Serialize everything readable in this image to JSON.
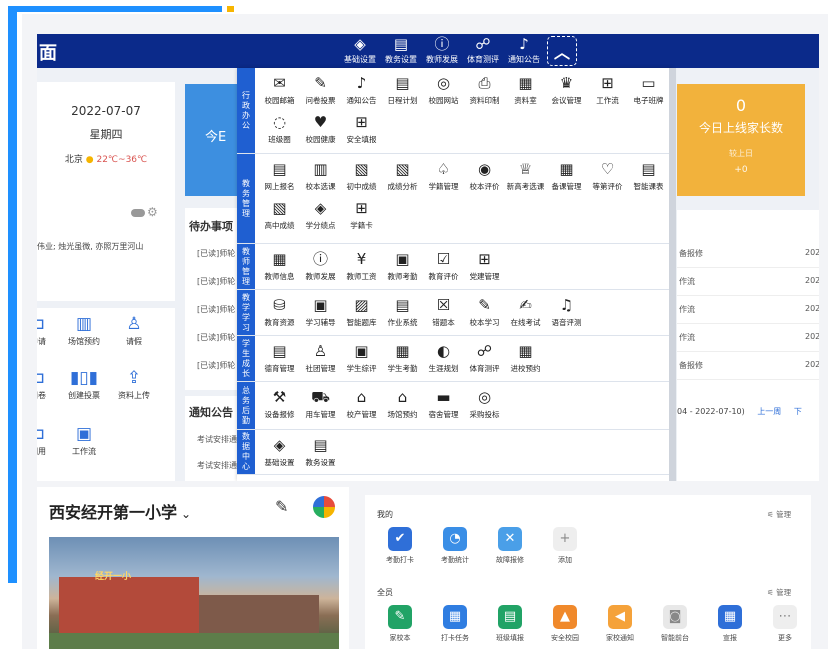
{
  "topbar": {
    "title": "面",
    "nav": [
      {
        "label": "基础设置",
        "icon": "layers-icon"
      },
      {
        "label": "教务设置",
        "icon": "document-icon"
      },
      {
        "label": "教师发展",
        "icon": "info-icon"
      },
      {
        "label": "体育测评",
        "icon": "runner-icon"
      },
      {
        "label": "通知公告",
        "icon": "speaker-icon"
      }
    ],
    "collapse_icon": "chevron-up-icon"
  },
  "date_card": {
    "date": "2022-07-07",
    "weekday": "星期四",
    "city": "北京",
    "temp": "22℃~36℃"
  },
  "blue_card": {
    "label": "今E"
  },
  "orange_card": {
    "value": "0",
    "label": "今日上线家长数",
    "sub": "较上日",
    "delta": "+0"
  },
  "motto": "伟业; 烛光虽微, 亦照万里河山",
  "left_apps": [
    {
      "label": "申请",
      "icon": "bracket-icon"
    },
    {
      "label": "场馆预约",
      "icon": "building-icon"
    },
    {
      "label": "请假",
      "icon": "person-clock-icon"
    },
    {
      "label": "问卷",
      "icon": "bracket-icon"
    },
    {
      "label": "创建投票",
      "icon": "bar-chart-icon"
    },
    {
      "label": "资料上传",
      "icon": "cloud-upload-icon"
    },
    {
      "label": "调用",
      "icon": "bracket-icon"
    },
    {
      "label": "工作流",
      "icon": "clipboard-icon"
    }
  ],
  "todo": {
    "title": "待办事项",
    "rows": [
      "[已读]师轮",
      "[已读]师轮",
      "[已读]师轮",
      "[已读]师轮",
      "[已读]师轮"
    ]
  },
  "notice": {
    "title": "通知公告",
    "rows": [
      "考试安排通",
      "考试安排通"
    ]
  },
  "right_rows": [
    {
      "a": "备报修",
      "b": "202"
    },
    {
      "a": "作流",
      "b": "202"
    },
    {
      "a": "作流",
      "b": "202"
    },
    {
      "a": "作流",
      "b": "202"
    },
    {
      "a": "备报修",
      "b": "202"
    }
  ],
  "range": {
    "text": "04 - 2022-07-10)",
    "prev": "上一周",
    "next": "下"
  },
  "menu": [
    {
      "label": "行政办公",
      "items": [
        {
          "t": "校园邮箱",
          "g": "✉"
        },
        {
          "t": "问卷投票",
          "g": "✎"
        },
        {
          "t": "通知公告",
          "g": "♪"
        },
        {
          "t": "日程计划",
          "g": "▤"
        },
        {
          "t": "校园网站",
          "g": "◎"
        },
        {
          "t": "资料印制",
          "g": "⎙"
        },
        {
          "t": "资料室",
          "g": "▦"
        },
        {
          "t": "会议管理",
          "g": "♛"
        },
        {
          "t": "工作流",
          "g": "⊞"
        },
        {
          "t": "电子班牌",
          "g": "▭"
        },
        {
          "t": "班级圈",
          "g": "◌"
        },
        {
          "t": "校园健康",
          "g": "♥"
        },
        {
          "t": "安全填报",
          "g": "⊞"
        }
      ]
    },
    {
      "label": "教务管理",
      "items": [
        {
          "t": "网上报名",
          "g": "▤"
        },
        {
          "t": "校本选课",
          "g": "▥"
        },
        {
          "t": "初中成绩",
          "g": "▧"
        },
        {
          "t": "成绩分析",
          "g": "▧"
        },
        {
          "t": "学籍管理",
          "g": "♤"
        },
        {
          "t": "校本评价",
          "g": "◉"
        },
        {
          "t": "新高考选课",
          "g": "♕"
        },
        {
          "t": "备课管理",
          "g": "▦"
        },
        {
          "t": "等第评价",
          "g": "♡"
        },
        {
          "t": "智能课表",
          "g": "▤"
        },
        {
          "t": "高中成绩",
          "g": "▧"
        },
        {
          "t": "学分绩点",
          "g": "◈"
        },
        {
          "t": "学籍卡",
          "g": "⊞"
        }
      ]
    },
    {
      "label": "教师管理",
      "items": [
        {
          "t": "教师信息",
          "g": "▦"
        },
        {
          "t": "教师发展",
          "g": "ⓘ"
        },
        {
          "t": "教师工资",
          "g": "¥"
        },
        {
          "t": "教师考勤",
          "g": "▣"
        },
        {
          "t": "教育评价",
          "g": "☑"
        },
        {
          "t": "党建管理",
          "g": "⊞"
        }
      ]
    },
    {
      "label": "教学学习",
      "items": [
        {
          "t": "教育资源",
          "g": "⛁"
        },
        {
          "t": "学习辅导",
          "g": "▣"
        },
        {
          "t": "智能题库",
          "g": "▨"
        },
        {
          "t": "作业系统",
          "g": "▤"
        },
        {
          "t": "错题本",
          "g": "☒"
        },
        {
          "t": "校本学习",
          "g": "✎"
        },
        {
          "t": "在线考试",
          "g": "✍"
        },
        {
          "t": "语音评测",
          "g": "♫"
        }
      ]
    },
    {
      "label": "学生成长",
      "items": [
        {
          "t": "德育管理",
          "g": "▤"
        },
        {
          "t": "社团管理",
          "g": "♙"
        },
        {
          "t": "学生综评",
          "g": "▣"
        },
        {
          "t": "学生考勤",
          "g": "▦"
        },
        {
          "t": "生涯规划",
          "g": "◐"
        },
        {
          "t": "体育测评",
          "g": "☍"
        },
        {
          "t": "进校预约",
          "g": "▦"
        }
      ]
    },
    {
      "label": "总务后勤",
      "items": [
        {
          "t": "设备报修",
          "g": "⚒"
        },
        {
          "t": "用车管理",
          "g": "⛟"
        },
        {
          "t": "校产管理",
          "g": "⌂"
        },
        {
          "t": "场馆预约",
          "g": "⌂"
        },
        {
          "t": "宿舍管理",
          "g": "▬"
        },
        {
          "t": "采购投标",
          "g": "◎"
        }
      ]
    },
    {
      "label": "数据中心",
      "items": [
        {
          "t": "基础设置",
          "g": "◈"
        },
        {
          "t": "教务设置",
          "g": "▤"
        }
      ]
    }
  ],
  "mobile": {
    "school": "西安经开第一小学",
    "photo_sign": "经开一小"
  },
  "workbench": {
    "mine_title": "我的",
    "all_title": "全员",
    "manage": "管理",
    "mine": [
      {
        "t": "考勤打卡",
        "c": "#2f6fd8",
        "g": "✔"
      },
      {
        "t": "考勤统计",
        "c": "#3a8ee6",
        "g": "◔"
      },
      {
        "t": "故障报修",
        "c": "#4a9fe8",
        "g": "✕"
      },
      {
        "t": "添加",
        "c": "#eeeeee",
        "g": "+"
      }
    ],
    "all": [
      {
        "t": "家校本",
        "c": "#21a366",
        "g": "✎"
      },
      {
        "t": "打卡任务",
        "c": "#2f7de1",
        "g": "▦"
      },
      {
        "t": "班级填报",
        "c": "#21a366",
        "g": "▤"
      },
      {
        "t": "安全校园",
        "c": "#f0892b",
        "g": "▲"
      },
      {
        "t": "家校通知",
        "c": "#f5a23a",
        "g": "◀"
      },
      {
        "t": "智能前台",
        "c": "#e8e8e8",
        "g": "◙"
      },
      {
        "t": "宣报",
        "c": "#2f6fd8",
        "g": "▦"
      },
      {
        "t": "更多",
        "c": "#eeeeee",
        "g": "⋯"
      }
    ]
  }
}
